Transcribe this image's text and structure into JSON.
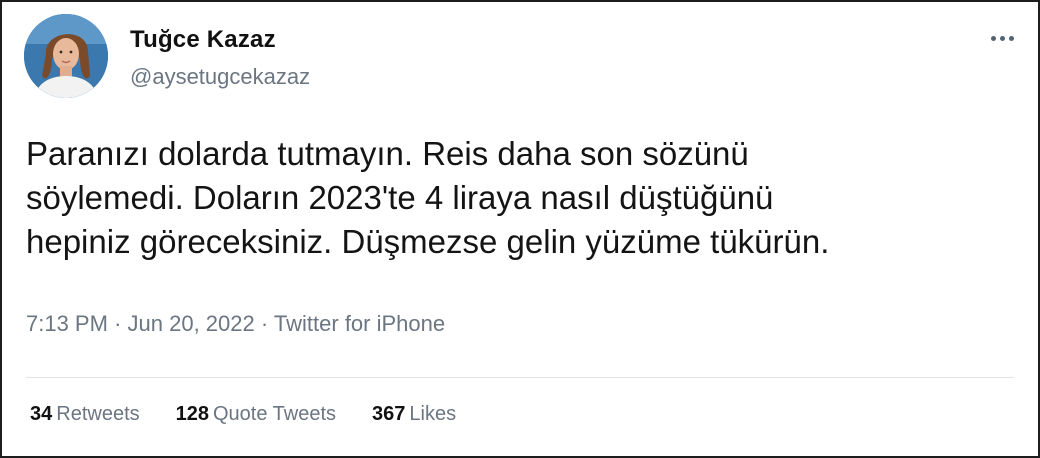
{
  "author": {
    "display_name": "Tuğce Kazaz",
    "handle": "@aysetugcekazaz",
    "avatar_icon": "profile-photo"
  },
  "more_icon": "more-horizontal-icon",
  "tweet": {
    "lines": [
      "Paranızı dolarda tutmayın. Reis daha son sözünü",
      "söylemedi. Doların 2023'te 4 liraya nasıl düştüğünü",
      "hepiniz göreceksiniz. Düşmezse gelin yüzüme tükürün."
    ]
  },
  "meta": {
    "time": "7:13 PM",
    "separator": "·",
    "date": "Jun 20, 2022",
    "source": "Twitter for iPhone"
  },
  "stats": {
    "retweets": {
      "count": "34",
      "label": "Retweets"
    },
    "quotes": {
      "count": "128",
      "label": "Quote Tweets"
    },
    "likes": {
      "count": "367",
      "label": "Likes"
    }
  },
  "colors": {
    "text": "#141414",
    "secondary": "#6b7682",
    "border": "#1d1d1d"
  }
}
